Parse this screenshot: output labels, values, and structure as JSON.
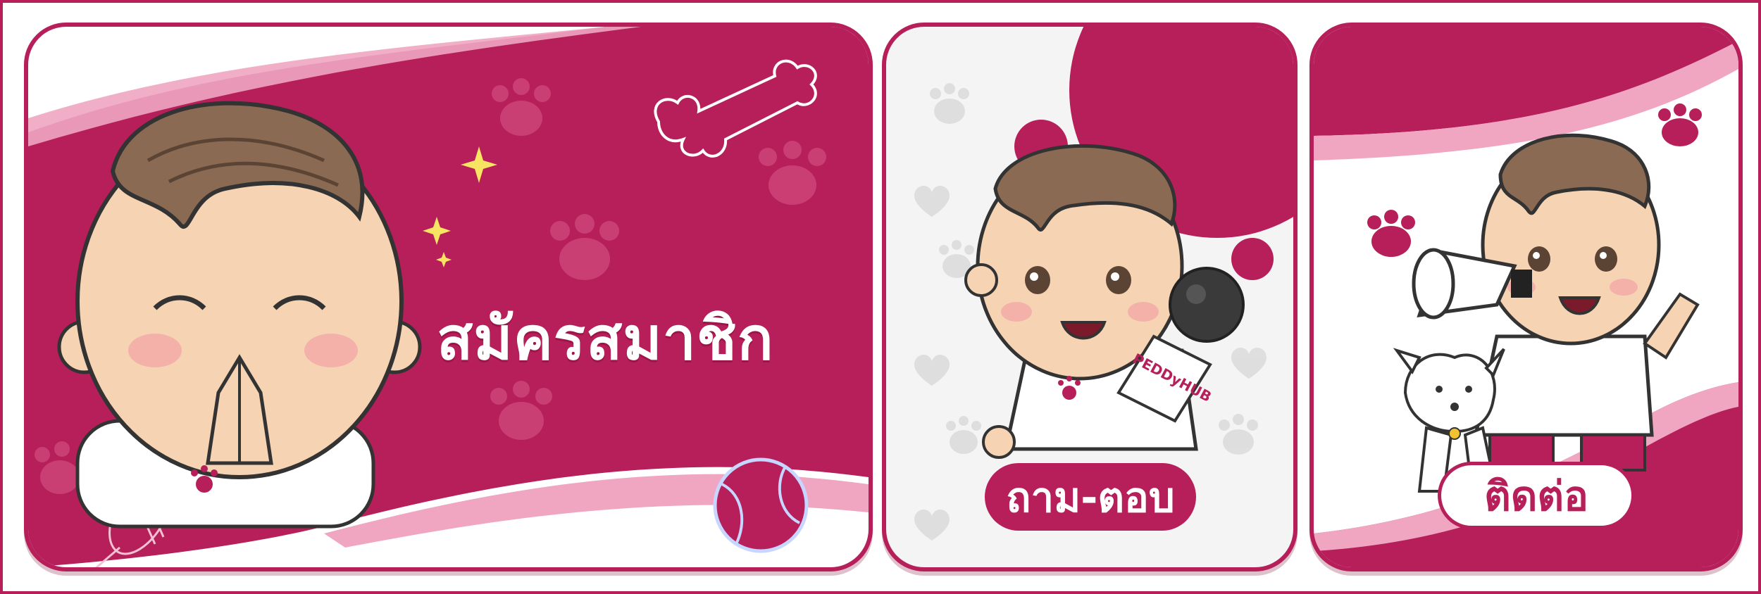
{
  "banner": {
    "register_label": "สมัครสมาชิก",
    "qa_label": "ถาม-ตอบ",
    "contact_label": "ติดต่อ",
    "mic_brand": "PEDDyHUB"
  },
  "colors": {
    "brand": "#b61f59",
    "accent_pink": "#f0a5c1",
    "skin": "#f6d3b2",
    "hair": "#8a6a52"
  },
  "icons": [
    "paw-icon",
    "bone-icon",
    "tennis-ball-icon",
    "brush-icon",
    "sparkle-icon",
    "heart-icon",
    "microphone-icon",
    "megaphone-icon",
    "dog-icon"
  ]
}
